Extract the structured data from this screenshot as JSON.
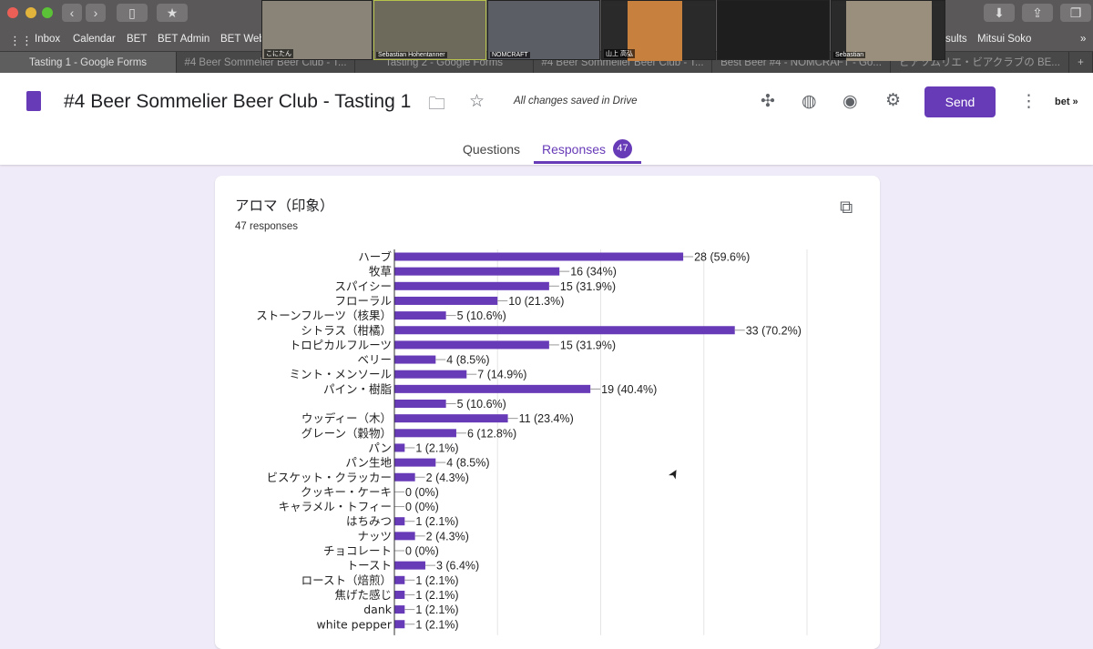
{
  "browser": {
    "bookmarks": [
      "Inbox",
      "Calendar",
      "BET",
      "BET Admin",
      "BET Web",
      "sults",
      "Mitsui Soko"
    ],
    "tabs": [
      "Tasting 1 - Google Forms",
      "#4 Beer Sommelier Beer Club - T...",
      "Tasting 2 - Google Forms",
      "#4 Beer Sommelier Beer Club - T...",
      "Best Beer #4 - NOMCRAFT - Go...",
      "ビアソムリエ・ビアクラブの BE..."
    ],
    "video_participants": [
      "こにたん",
      "Sebastian Hohentanner",
      "NOMCRAFT",
      "山上 高弘",
      "Sebastian"
    ]
  },
  "header": {
    "title": "#4 Beer Sommelier Beer Club - Tasting 1",
    "save_status": "All changes saved in Drive",
    "send_label": "Send",
    "account": "bet »",
    "tabs": {
      "questions": "Questions",
      "responses": "Responses",
      "responses_count": "47"
    }
  },
  "colors": {
    "accent": "#673ab7",
    "background": "#f0ebf8"
  },
  "question": {
    "title": "アロマ（印象）",
    "response_count": "47 responses"
  },
  "chart_data": {
    "type": "bar",
    "orientation": "horizontal",
    "xlim": [
      0,
      40
    ],
    "grid": true,
    "categories": [
      "ハーブ",
      "牧草",
      "スパイシー",
      "フローラル",
      "ストーンフルーツ（核果）",
      "シトラス（柑橘）",
      "トロピカルフルーツ",
      "ベリー",
      "ミント・メンソール",
      "パイン・樹脂",
      "",
      "ウッディー（木）",
      "グレーン（穀物）",
      "パン",
      "パン生地",
      "ビスケット・クラッカー",
      "クッキー・ケーキ",
      "キャラメル・トフィー",
      "はちみつ",
      "ナッツ",
      "チョコレート",
      "トースト",
      "ロースト（焙煎）",
      "焦げた感じ",
      "dank",
      "white pepper"
    ],
    "values": [
      28,
      16,
      15,
      10,
      5,
      33,
      15,
      4,
      7,
      19,
      5,
      11,
      6,
      1,
      4,
      2,
      0,
      0,
      1,
      2,
      0,
      3,
      1,
      1,
      1,
      1
    ],
    "labels": [
      "28 (59.6%)",
      "16 (34%)",
      "15 (31.9%)",
      "10 (21.3%)",
      "5 (10.6%)",
      "33 (70.2%)",
      "15 (31.9%)",
      "4 (8.5%)",
      "7 (14.9%)",
      "19 (40.4%)",
      "5 (10.6%)",
      "11 (23.4%)",
      "6 (12.8%)",
      "1 (2.1%)",
      "4 (8.5%)",
      "2 (4.3%)",
      "0 (0%)",
      "0 (0%)",
      "1 (2.1%)",
      "2 (4.3%)",
      "0 (0%)",
      "3 (6.4%)",
      "1 (2.1%)",
      "1 (2.1%)",
      "1 (2.1%)",
      "1 (2.1%)"
    ]
  }
}
